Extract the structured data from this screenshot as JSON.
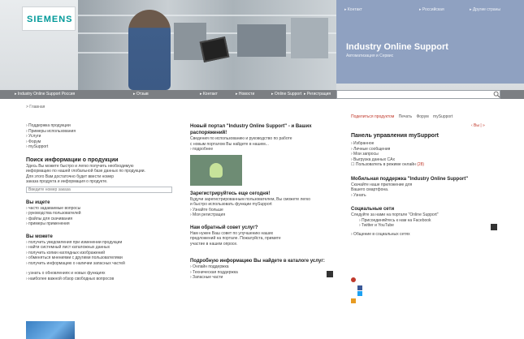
{
  "header": {
    "logo": "SIEMENS",
    "top_links": [
      "▸ Контакт",
      "▸ Российская",
      "▸ Другие страны"
    ],
    "title": "Industry Online Support",
    "subtitle": "Автоматизация и Сервис"
  },
  "navbar": {
    "items": [
      "▸ Industry Online Support Россия",
      "▸ Отзыв",
      "▸ Контакт",
      "▸ Новости",
      "▸ Online Support",
      "▸ Регистрация"
    ],
    "search_placeholder": ""
  },
  "breadcrumb": "> Главная",
  "tools": [
    "Поделиться продуктом",
    "Печать",
    "Форум",
    "mySupport"
  ],
  "left_col": {
    "links": [
      "› Поддержка продукции",
      "› Примеры использования",
      "› Услуги",
      "› Форум",
      "› mySupport"
    ],
    "section1_title": "Поиск информации о продукции",
    "section1_text": [
      "Здесь Вы можете быстро и легко получить необходимую",
      "информацию по нашей глобальной базе данных по продукции.",
      "Для этого Вам достаточно будет ввести номер",
      "заказа продукта и информация о продукте."
    ],
    "search_label": "Введите номер заказа",
    "section2_title": "Вы ищете",
    "section2_items": [
      "› часто задаваемые вопросы",
      "› руководства пользователей",
      "› файлы для скачивания",
      "› примеры применения"
    ],
    "section3_title": "Вы можете",
    "section3_items": [
      "› получить уведомления при изменении продукции",
      "› найти системный лист каталожных данных",
      "› получить копии наглядных изображений",
      "› обменяться мнениями с другими пользователями",
      "› получить информацию о наличии запасных частей"
    ],
    "footer_links": [
      "› узнать о обновлениях и новых функциях",
      "› наиболее важной обзор свободных вопросов"
    ]
  },
  "mid_col": {
    "sec1_title": "Новый портал \"Industry Online Support\" - и Ваших распоряжений!",
    "sec1_text": [
      "Сведения по использованию и руководство по работе",
      "с новым порталом Вы найдете в нашем...",
      "› подробнее"
    ],
    "sec2_title": "Зарегистрируйтесь еще сегодня!",
    "sec2_text": [
      "Будучи зарегистрированным пользователем, Вы сможете легко",
      "и быстро использовать функции mySupport",
      "› Узнайте больше",
      "› Моя регистрация"
    ],
    "sec3_title": "Нам обратный совет услуг?",
    "sec3_text": [
      "Нам нужен Ваш совет по улучшению наших",
      "предложений на портале. Пожалуйста, примите",
      "участие в нашем опросе."
    ],
    "sec4_title": "Подробную информацию Вы найдете в каталоге услуг:",
    "sec4_items": [
      "› Онлайн поддержка",
      "› Техническая поддержка",
      "› Запасные части"
    ]
  },
  "right_col": {
    "pager": "‹ Вы  |  »",
    "panel_title": "Панель управления mySupport",
    "panel_items": [
      "› Избранное",
      "› Личные сообщения",
      "› Мои запросы",
      "› Выгрузка данных CAx"
    ],
    "panel_check": "Пользователь в режиме онлайн",
    "panel_check_count": "(28)",
    "mobile_title": "Мобильная поддержка \"Industry Online Support\"",
    "mobile_text": [
      "Скачайте наше приложение для",
      "Вашего смартфона.",
      "› Узнать"
    ],
    "social_title": "Социальные сети",
    "social_items": [
      "Следуйте за нами на портале \"Online Support\"",
      "› Присоединяйтесь к нам на Facebook",
      "› Twitter и YouTube",
      "› Общение в социальных сетях"
    ]
  }
}
